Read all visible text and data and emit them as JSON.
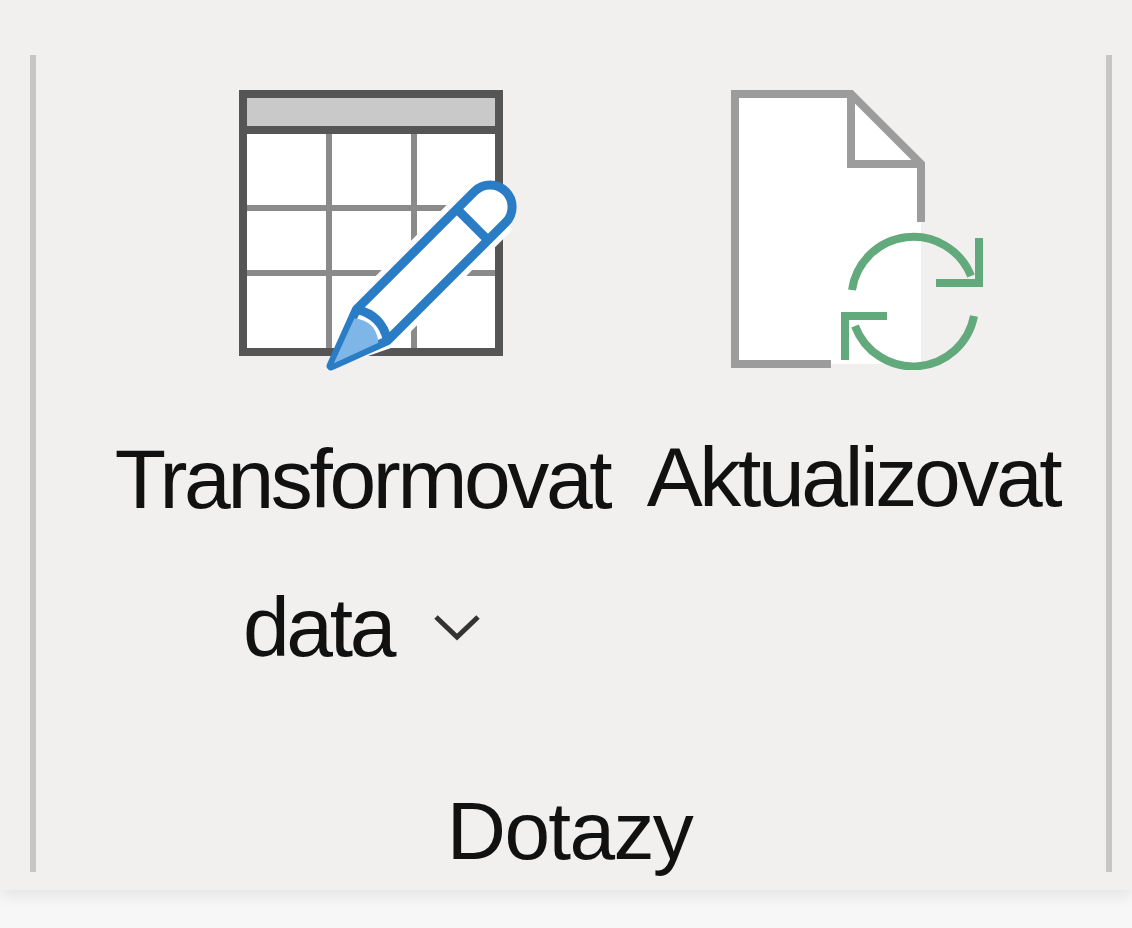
{
  "buttons": [
    {
      "label": "Transformovat data",
      "dropdown": true
    },
    {
      "label": "Aktualizovat",
      "dropdown": false
    }
  ],
  "group": {
    "label": "Dotazy"
  }
}
